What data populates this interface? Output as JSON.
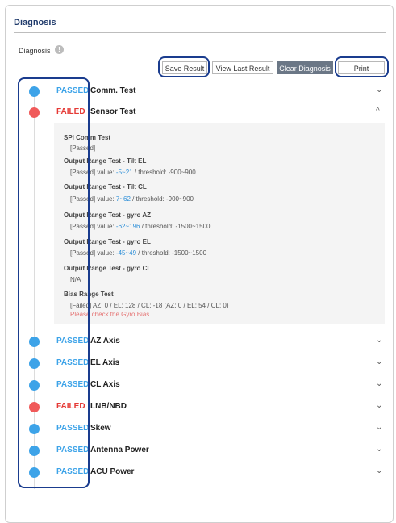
{
  "title": "Diagnosis",
  "diagnosis_label": "Diagnosis",
  "info_icon": "!",
  "buttons": {
    "save": "Save Result",
    "view_last": "View Last Result",
    "clear": "Clear Diagnosis",
    "print": "Print"
  },
  "tests": [
    {
      "status": "PASSED",
      "name": "Comm. Test",
      "state": "pass",
      "chevron": "⌄"
    },
    {
      "status": "FAILED",
      "name": "Sensor Test",
      "state": "fail",
      "chevron": "^"
    },
    {
      "status": "PASSED",
      "name": "AZ Axis",
      "state": "pass",
      "chevron": "⌄"
    },
    {
      "status": "PASSED",
      "name": "EL Axis",
      "state": "pass",
      "chevron": "⌄"
    },
    {
      "status": "PASSED",
      "name": "CL Axis",
      "state": "pass",
      "chevron": "⌄"
    },
    {
      "status": "FAILED",
      "name": "LNB/NBD",
      "state": "fail",
      "chevron": "⌄"
    },
    {
      "status": "PASSED",
      "name": "Skew",
      "state": "pass",
      "chevron": "⌄"
    },
    {
      "status": "PASSED",
      "name": "Antenna Power",
      "state": "pass",
      "chevron": "⌄"
    },
    {
      "status": "PASSED",
      "name": "ACU Power",
      "state": "pass",
      "chevron": "⌄"
    }
  ],
  "sensor_details": {
    "spi_title": "SPI Comm Test",
    "spi_result": "[Passed]",
    "tilt_el_title": "Output Range Test - Tilt EL",
    "tilt_el_prefix": "[Passed] value: ",
    "tilt_el_value": "-5~21",
    "tilt_el_suffix": " / threshold: -900~900",
    "tilt_cl_title": "Output Range Test - Tilt CL",
    "tilt_cl_prefix": "[Passed] value: ",
    "tilt_cl_value": "7~62",
    "tilt_cl_suffix": " / threshold: -900~900",
    "gyro_az_title": "Output Range Test - gyro AZ",
    "gyro_az_prefix": "[Passed] value: ",
    "gyro_az_value": "-62~196",
    "gyro_az_suffix": " / threshold: -1500~1500",
    "gyro_el_title": "Output Range Test - gyro EL",
    "gyro_el_prefix": "[Passed] value: ",
    "gyro_el_value": "-45~49",
    "gyro_el_suffix": " / threshold: -1500~1500",
    "gyro_cl_title": "Output Range Test - gyro CL",
    "gyro_cl_result": "N/A",
    "bias_title": "Bias Range Test",
    "bias_result": "[Failed] AZ: 0 / EL: 128 / CL: -18 (AZ: 0 / EL: 54 / CL: 0)",
    "bias_note": "Please check the Gyro Bias."
  },
  "colors": {
    "pass": "#3da3e8",
    "fail": "#e53935",
    "title": "#1f3a6b",
    "highlight": "#1a3c8e"
  }
}
